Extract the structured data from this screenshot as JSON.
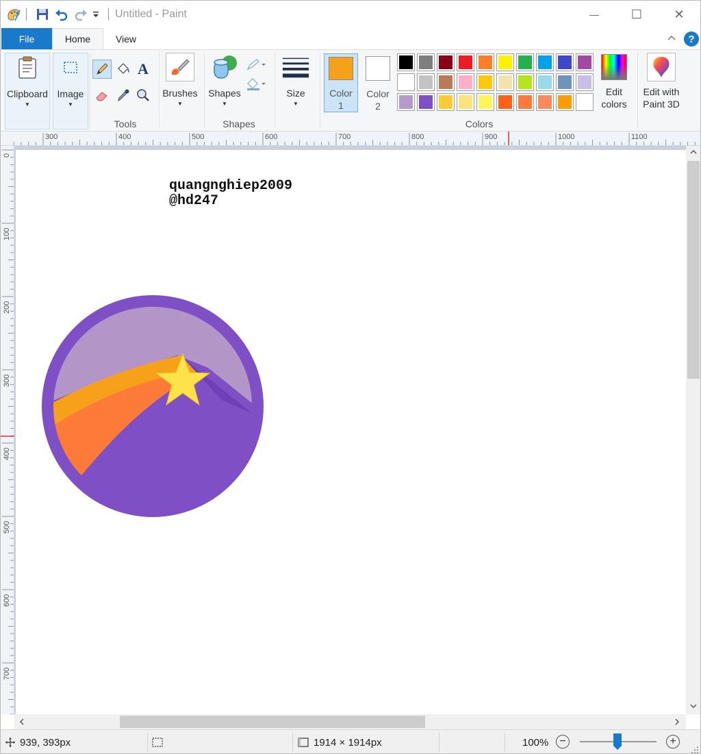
{
  "window": {
    "title": "Untitled - Paint",
    "minimize_glyph": "—",
    "maximize_glyph": "☐",
    "close_glyph": "✕"
  },
  "tabs": [
    {
      "label": "File"
    },
    {
      "label": "Home"
    },
    {
      "label": "View"
    }
  ],
  "ribbon": {
    "clipboard_label": "Clipboard",
    "image_label": "Image",
    "tools_label": "Tools",
    "brushes_label": "Brushes",
    "shapes_btn_label": "Shapes",
    "shapes_group_label": "Shapes",
    "size_label": "Size",
    "color1_label": "Color",
    "color1_num": "1",
    "color2_label": "Color",
    "color2_num": "2",
    "colors_group_label": "Colors",
    "edit_colors_line1": "Edit",
    "edit_colors_line2": "colors",
    "edit3d_line1": "Edit with",
    "edit3d_line2": "Paint 3D",
    "text_tool_glyph": "A",
    "help_glyph": "?"
  },
  "colors": {
    "accent": "#1979ca",
    "color1": "#f7a11a",
    "color2": "#ffffff",
    "palette_row1": [
      "#000000",
      "#7f7f7f",
      "#880015",
      "#ed1c24",
      "#ff7f27",
      "#fff200",
      "#22b14c",
      "#00a2e8",
      "#3f48cc",
      "#a349a4"
    ],
    "palette_row2": [
      "#ffffff",
      "#c3c3c3",
      "#b97a57",
      "#ffaec9",
      "#ffc90e",
      "#efe4b0",
      "#b5e61d",
      "#99d9ea",
      "#7092be",
      "#c8bfe7"
    ],
    "palette_row3": [
      "#b59bcb",
      "#7e4fc5",
      "#fdcb33",
      "#fde27d",
      "#fdf559",
      "#fe6119",
      "#fe7a39",
      "#fe8a5b",
      "#fd9c06",
      "#ffffff"
    ]
  },
  "ruler": {
    "h_marks": [
      "300",
      "400",
      "500",
      "600",
      "700",
      "800",
      "900",
      "1000",
      "1100"
    ],
    "v_marks": [
      "0",
      "100",
      "200",
      "300",
      "400",
      "500",
      "600",
      "700"
    ]
  },
  "canvas": {
    "text_line1": "quangnghiep2009",
    "text_line2": "@hd247"
  },
  "status": {
    "cursor_pos": "939, 393px",
    "image_size": "1914 × 1914px",
    "zoom": "100%",
    "zoom_minus": "−",
    "zoom_plus": "+"
  }
}
